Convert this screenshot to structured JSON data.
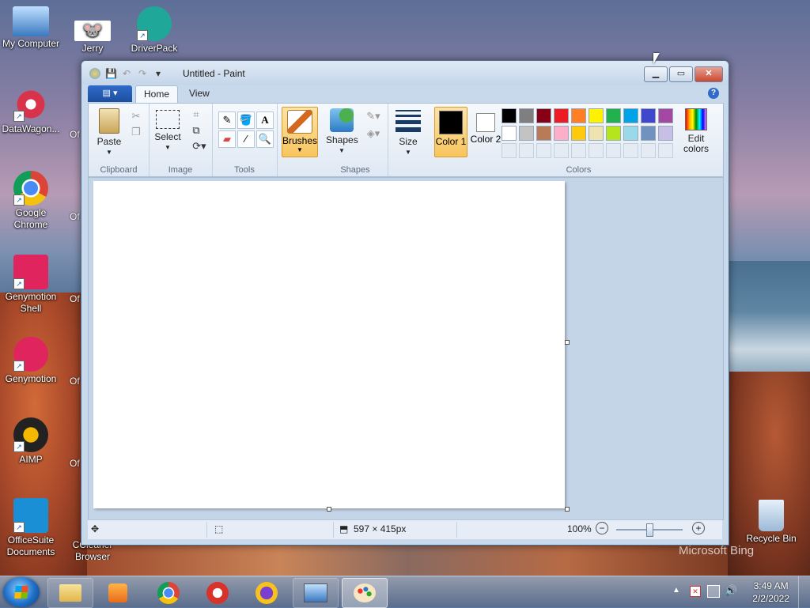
{
  "desktop": {
    "icons": [
      {
        "label": "My Computer"
      },
      {
        "label": "Jerry"
      },
      {
        "label": "DriverPack"
      },
      {
        "label": "DataWagon..."
      },
      {
        "label": "Google Chrome"
      },
      {
        "label": "Genymotion Shell"
      },
      {
        "label": "Genymotion"
      },
      {
        "label": "AIMP"
      },
      {
        "label": "OfficeSuite Documents"
      },
      {
        "label": "CCleaner Browser"
      },
      {
        "label": "Recycle Bin"
      }
    ],
    "partial_labels": [
      "Of",
      "Of",
      "Of",
      "Of",
      "Of",
      "C"
    ],
    "watermark": "Microsoft Bing"
  },
  "window": {
    "title": "Untitled - Paint",
    "tabs": {
      "home": "Home",
      "view": "View"
    },
    "ribbon": {
      "clipboard": {
        "paste": "Paste",
        "label": "Clipboard"
      },
      "image": {
        "select": "Select",
        "label": "Image"
      },
      "tools": {
        "label": "Tools"
      },
      "brushes": "Brushes",
      "shapes": {
        "button": "Shapes",
        "label": "Shapes"
      },
      "size": "Size",
      "colors": {
        "color1": "Color 1",
        "color2": "Color 2",
        "edit": "Edit colors",
        "label": "Colors",
        "color1_value": "#000000",
        "color2_value": "#ffffff",
        "palette_row1": [
          "#000000",
          "#7f7f7f",
          "#880015",
          "#ed1c24",
          "#ff7f27",
          "#fff200",
          "#22b14c",
          "#00a2e8",
          "#3f48cc",
          "#a349a4"
        ],
        "palette_row2": [
          "#ffffff",
          "#c3c3c3",
          "#b97a57",
          "#ffaec9",
          "#ffc90e",
          "#efe4b0",
          "#b5e61d",
          "#99d9ea",
          "#7092be",
          "#c8bfe7"
        ]
      }
    },
    "status": {
      "canvas_size": "597 × 415px",
      "zoom": "100%"
    }
  },
  "taskbar": {
    "time": "3:49 AM",
    "date": "2/2/2022"
  }
}
